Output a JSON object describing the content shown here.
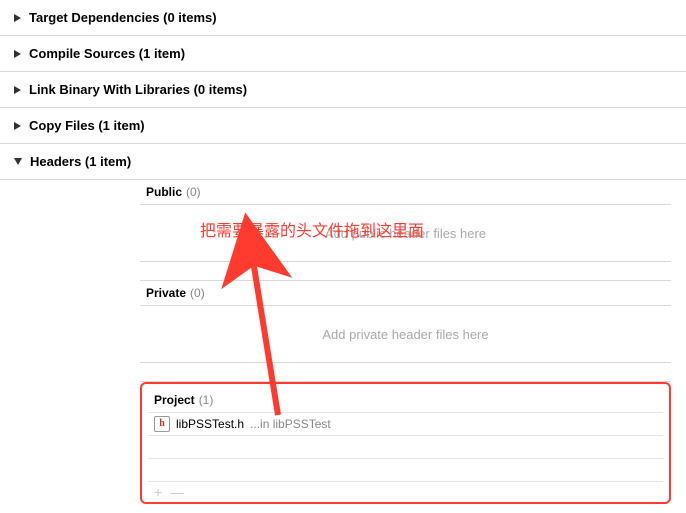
{
  "phases": {
    "target_deps": "Target Dependencies (0 items)",
    "compile_sources": "Compile Sources (1 item)",
    "link_binary": "Link Binary With Libraries (0 items)",
    "copy_files": "Copy Files (1 item)",
    "headers": "Headers (1 item)"
  },
  "headers": {
    "public": {
      "label": "Public",
      "count": "(0)",
      "placeholder": "Add public header files here"
    },
    "private": {
      "label": "Private",
      "count": "(0)",
      "placeholder": "Add private header files here"
    },
    "project": {
      "label": "Project",
      "count": "(1)",
      "file": {
        "icon": "h",
        "name": "libPSSTest.h",
        "location": "...in libPSSTest"
      }
    }
  },
  "footer": {
    "plus": "+",
    "minus": "—"
  },
  "annotation": "把需要暴露的头文件拖到这里面"
}
